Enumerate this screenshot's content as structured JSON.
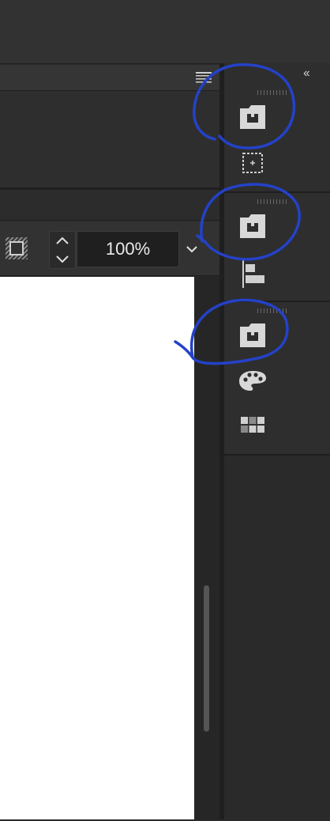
{
  "zoom": {
    "value": "100%"
  },
  "dock": {
    "collapse_label": "‹‹",
    "groups": [
      {
        "icons": [
          "library-folder-icon",
          "artboard-icon"
        ]
      },
      {
        "icons": [
          "library-folder-icon",
          "align-left-icon"
        ]
      },
      {
        "icons": [
          "library-folder-icon",
          "color-palette-icon",
          "swatches-icon"
        ]
      }
    ]
  },
  "colors": {
    "annotation": "#2442c8",
    "canvas": "#ffffff",
    "chrome": "#2e2e2e"
  }
}
